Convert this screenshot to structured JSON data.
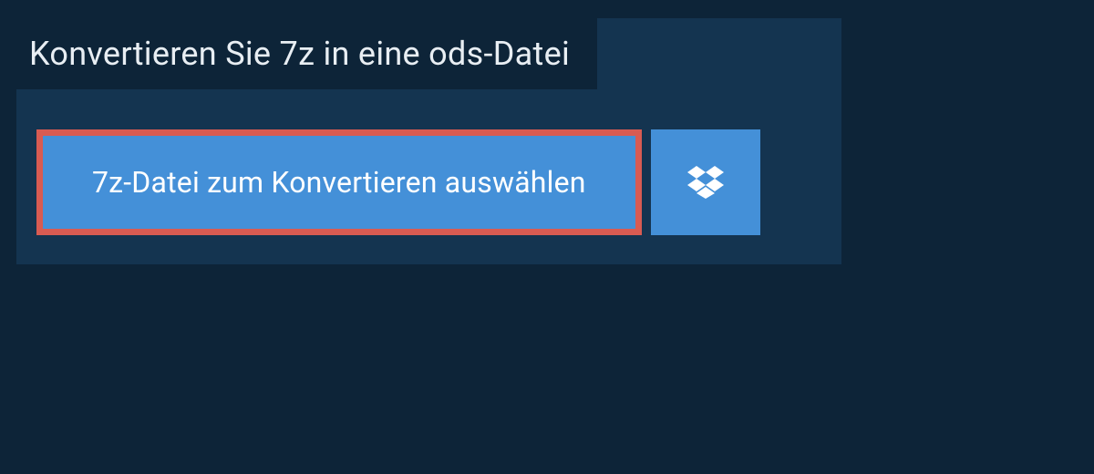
{
  "header": {
    "title": "Konvertieren Sie 7z in eine ods-Datei"
  },
  "upload": {
    "select_file_label": "7z-Datei zum Konvertieren auswählen"
  },
  "colors": {
    "background": "#0d2438",
    "panel": "#143450",
    "primary_button": "#4490d8",
    "highlight_border": "#d85b52",
    "text_light": "#e8eef3"
  }
}
